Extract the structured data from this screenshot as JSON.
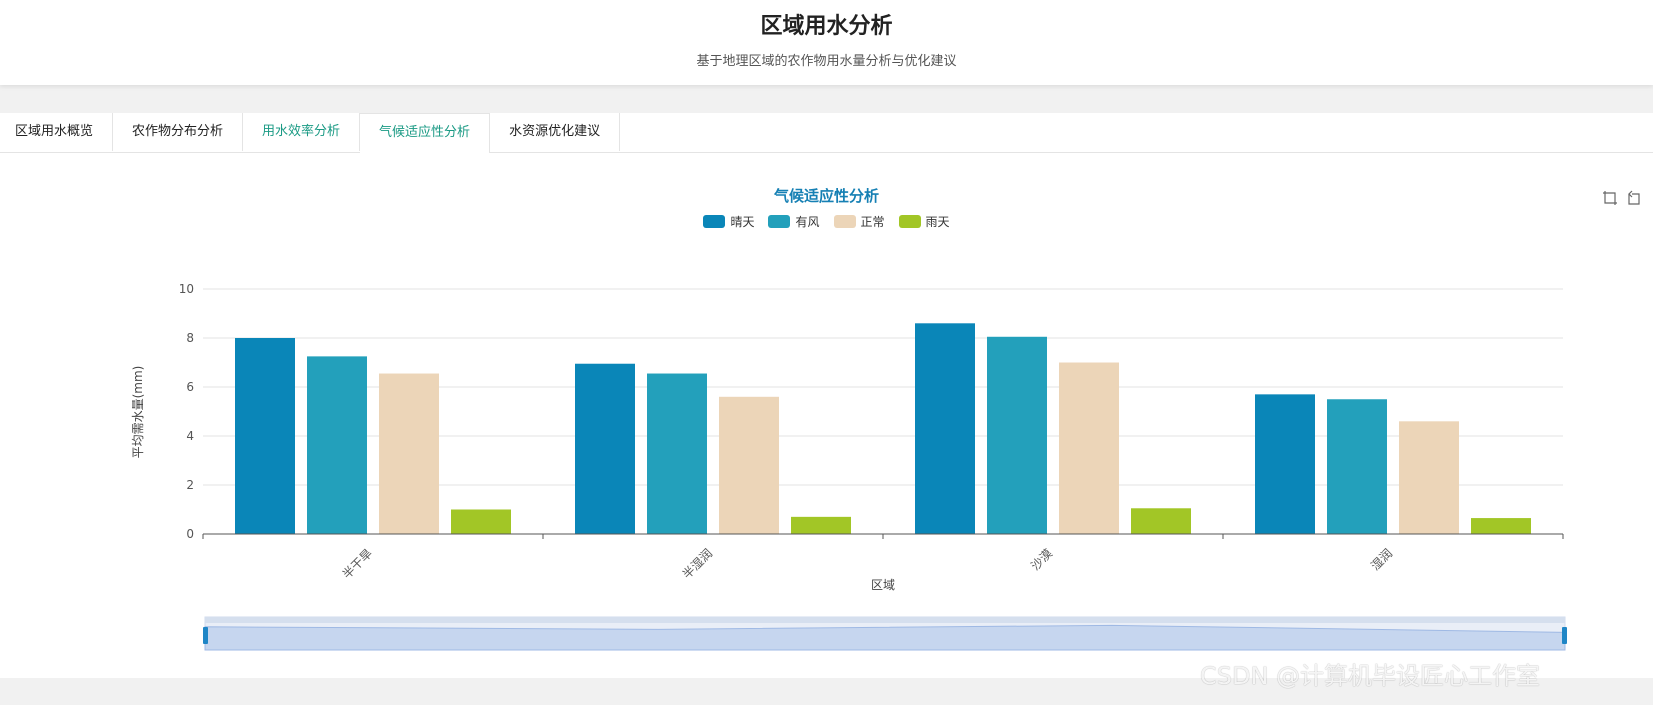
{
  "header": {
    "title": "区域用水分析",
    "subtitle": "基于地理区域的农作物用水量分析与优化建议"
  },
  "tabs": [
    {
      "label": "区域用水概览"
    },
    {
      "label": "农作物分布分析"
    },
    {
      "label": "用水效率分析"
    },
    {
      "label": "气候适应性分析"
    },
    {
      "label": "水资源优化建议"
    }
  ],
  "toolbox": {
    "icons": [
      "zoom-select-icon",
      "zoom-reset-icon"
    ]
  },
  "watermark": "CSDN @计算机毕设匠心工作室",
  "chart_data": {
    "type": "bar",
    "title": "气候适应性分析",
    "xlabel": "区域",
    "ylabel": "平均需水量(mm)",
    "ylim": [
      0,
      10
    ],
    "yticks": [
      0,
      2,
      4,
      6,
      8,
      10
    ],
    "grid": true,
    "legend_position": "top-center",
    "categories": [
      "半干旱",
      "半湿润",
      "沙漠",
      "湿润"
    ],
    "series": [
      {
        "name": "晴天",
        "color": "#0a86b8",
        "values": [
          8.0,
          6.95,
          8.6,
          5.7
        ]
      },
      {
        "name": "有风",
        "color": "#23a0bb",
        "values": [
          7.25,
          6.55,
          8.05,
          5.5
        ]
      },
      {
        "name": "正常",
        "color": "#ecd5b8",
        "values": [
          6.55,
          5.6,
          7.0,
          4.6
        ]
      },
      {
        "name": "雨天",
        "color": "#a2c626",
        "values": [
          1.0,
          0.7,
          1.05,
          0.65
        ]
      }
    ],
    "datazoom": {
      "start_percent": 0,
      "end_percent": 100
    }
  }
}
